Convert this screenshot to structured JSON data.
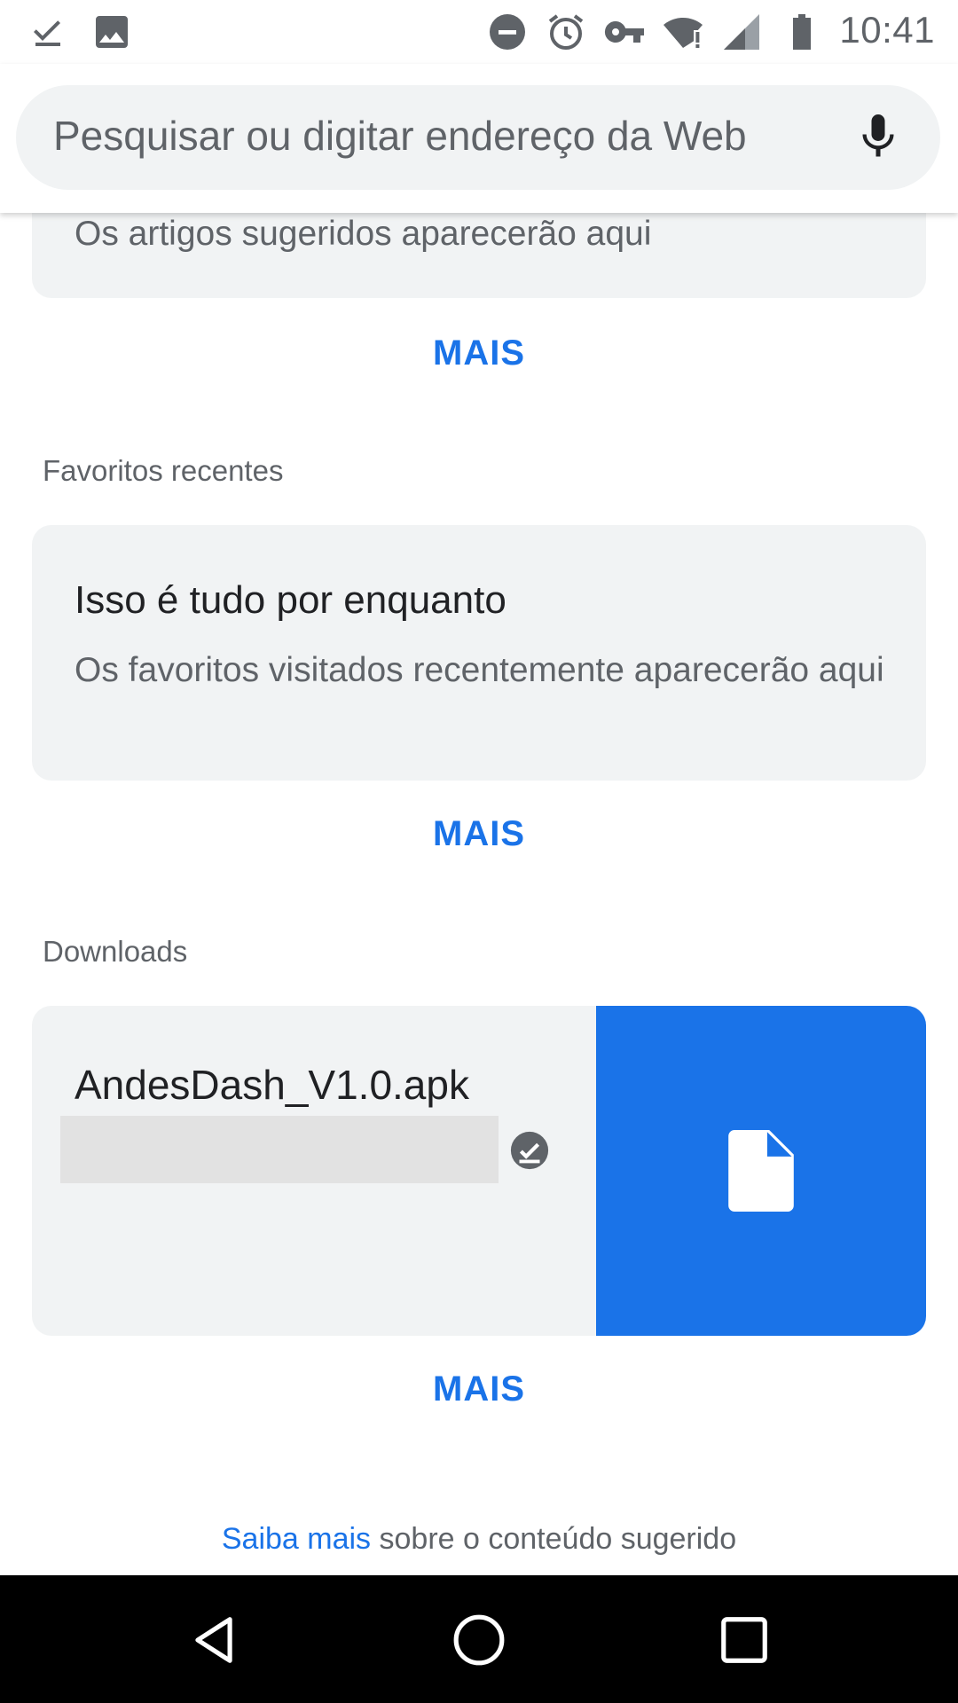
{
  "status_bar": {
    "time": "10:41",
    "left_icons": [
      "download-done-icon",
      "image-icon"
    ],
    "right_icons": [
      "do-not-disturb-icon",
      "alarm-icon",
      "vpn-key-icon",
      "wifi-alert-icon",
      "cell-signal-icon",
      "battery-icon"
    ]
  },
  "search": {
    "placeholder": "Pesquisar ou digitar endereço da Web",
    "mic_icon": "mic-icon"
  },
  "articles_section": {
    "card_text": "Os artigos sugeridos aparecerão aqui",
    "more_label": "MAIS"
  },
  "bookmarks_section": {
    "title": "Favoritos recentes",
    "card_title": "Isso é tudo por enquanto",
    "card_text": "Os favoritos visitados recentemente aparecerão aqui",
    "more_label": "MAIS"
  },
  "downloads_section": {
    "title": "Downloads",
    "file_name": "AndesDash_V1.0.apk",
    "file_icon": "file-icon",
    "status_icon": "check-circle-icon",
    "more_label": "MAIS"
  },
  "footer": {
    "link_text": "Saiba mais",
    "text": " sobre o conteúdo sugerido"
  },
  "colors": {
    "accent": "#1a73e8",
    "card_bg": "#f1f3f4",
    "nav_bg": "#000000"
  }
}
